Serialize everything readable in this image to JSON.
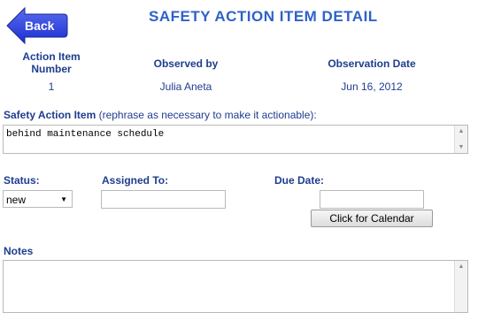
{
  "header": {
    "back_label": "Back",
    "title": "SAFETY ACTION ITEM DETAIL"
  },
  "summary": {
    "columns": [
      {
        "label_line1": "Action Item",
        "label_line2": "Number",
        "value": "1"
      },
      {
        "label": "Observed by",
        "value": "Julia Aneta"
      },
      {
        "label": "Observation Date",
        "value": "Jun 16, 2012"
      }
    ]
  },
  "action_item": {
    "label": "Safety Action Item",
    "hint": "(rephrase as necessary to make it actionable):",
    "value": "behind maintenance schedule"
  },
  "status": {
    "label": "Status:",
    "value": "new"
  },
  "assigned_to": {
    "label": "Assigned To:",
    "value": ""
  },
  "due_date": {
    "label": "Due Date:",
    "value": "",
    "calendar_button": "Click for Calendar"
  },
  "notes": {
    "label": "Notes",
    "value": ""
  },
  "colors": {
    "heading": "#1e3d8f",
    "title": "#2f62c9",
    "back_button": "#2a3fd6"
  }
}
